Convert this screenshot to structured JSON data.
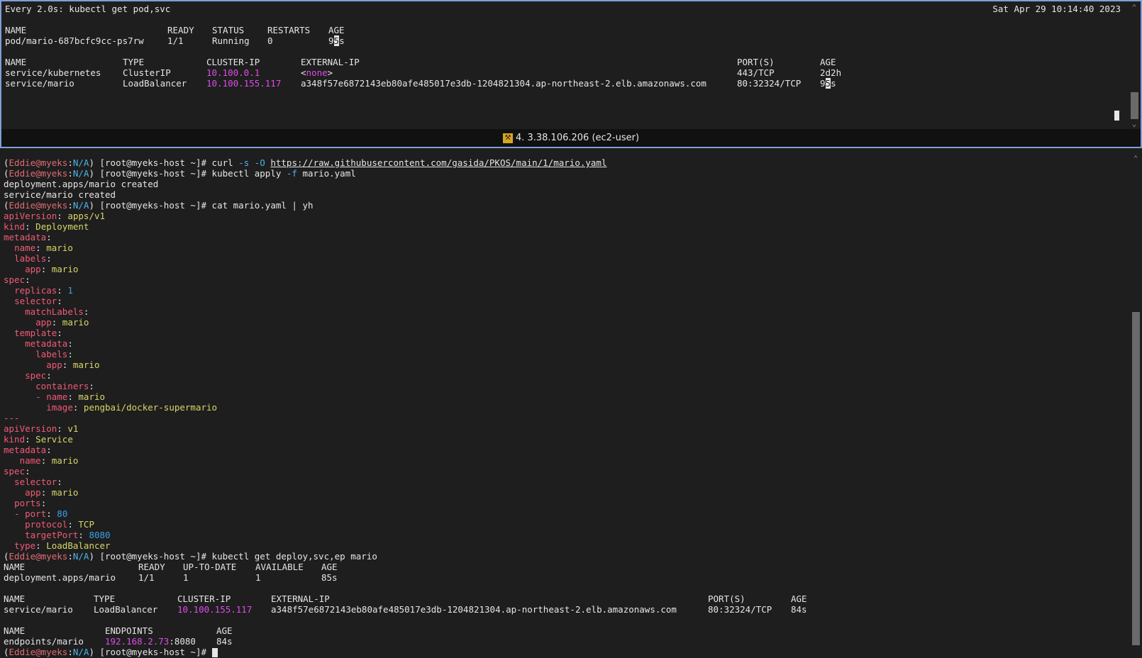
{
  "top_pane": {
    "header": "Every 2.0s: kubectl get pod,svc",
    "clock": "Sat Apr 29 10:14:40 2023",
    "pods_header": [
      "NAME",
      "READY",
      "STATUS",
      "RESTARTS",
      "AGE"
    ],
    "pod_row": {
      "name": "pod/mario-687bcfc9cc-ps7rw",
      "ready": "1/1",
      "status": "Running",
      "restarts": "0",
      "age_pre": "9",
      "age_cursor": "5",
      "age_post": "s"
    },
    "svc_header": [
      "NAME",
      "TYPE",
      "CLUSTER-IP",
      "EXTERNAL-IP",
      "PORT(S)",
      "AGE"
    ],
    "svc_rows": [
      {
        "name": "service/kubernetes",
        "type": "ClusterIP",
        "cluster_ip": "10.100.0.1",
        "external_ip_lt": "<",
        "external_ip": "none",
        "external_ip_gt": ">",
        "ports": "443/TCP",
        "age": "2d2h"
      },
      {
        "name": "service/mario",
        "type": "LoadBalancer",
        "cluster_ip": "10.100.155.117",
        "external_ip": "a348f57e6872143eb80afe485017e3db-1204821304.ap-northeast-2.elb.amazonaws.com",
        "ports": "80:32324/TCP",
        "age_pre": "9",
        "age_cursor": "5",
        "age_post": "s"
      }
    ],
    "status_bar": "4. 3.38.106.206 (ec2-user)"
  },
  "prompt": {
    "open": "(",
    "user": "Eddie@myeks",
    "colon": ":",
    "ns": "N/A",
    "close": ")",
    "host": " [root@myeks-host ~]# "
  },
  "bottom_pane": {
    "cmd1": {
      "a": "curl ",
      "flag": "-s -O",
      "url": "https://raw.githubusercontent.com/gasida/PKOS/main/1/mario.yaml"
    },
    "cmd2": {
      "a": "kubectl apply ",
      "flag": "-f",
      "b": " mario.yaml"
    },
    "out1": "deployment.apps/mario created",
    "out2": "service/mario created",
    "cmd3": "cat mario.yaml | yh",
    "yaml_sep": "---",
    "cmd4": "kubectl get deploy,svc,ep mario",
    "deploy_header": [
      "NAME",
      "READY",
      "UP-TO-DATE",
      "AVAILABLE",
      "AGE"
    ],
    "deploy_row": [
      "deployment.apps/mario",
      "1/1",
      "1",
      "1",
      "85s"
    ],
    "svc_header": [
      "NAME",
      "TYPE",
      "CLUSTER-IP",
      "EXTERNAL-IP",
      "PORT(S)",
      "AGE"
    ],
    "svc_row": [
      "service/mario",
      "LoadBalancer",
      "10.100.155.117",
      "a348f57e6872143eb80afe485017e3db-1204821304.ap-northeast-2.elb.amazonaws.com",
      "80:32324/TCP",
      "84s"
    ],
    "ep_header": [
      "NAME",
      "ENDPOINTS",
      "AGE"
    ],
    "ep_row": {
      "name": "endpoints/mario",
      "ip": "192.168.2.73",
      "port": ":8080",
      "age": "84s"
    }
  },
  "yaml": {
    "k_apiVersion": "apiVersion",
    "v_apps": "apps/v1",
    "k_kind": "kind",
    "v_deployment": "Deployment",
    "k_metadata": "metadata",
    "k_name": "name",
    "v_mario": "mario",
    "k_labels": "labels",
    "k_app": "app",
    "k_spec": "spec",
    "k_replicas": "replicas",
    "v_1": "1",
    "k_selector": "selector",
    "k_matchLabels": "matchLabels",
    "k_template": "template",
    "k_containers": "containers",
    "k_image": "image",
    "v_image": "pengbai/docker-supermario",
    "v_v1": "v1",
    "v_service": "Service",
    "k_ports": "ports",
    "k_port": "port",
    "v_80": "80",
    "k_protocol": "protocol",
    "v_tcp": "TCP",
    "k_targetPort": "targetPort",
    "v_8080": "8080",
    "k_type": "type",
    "v_lb": "LoadBalancer",
    "colon": ":",
    "colon_sp": ": ",
    "dash": "- "
  },
  "colors": {
    "background": "#1e1e1e",
    "ip_magenta": "#dd4ce6",
    "yaml_key": "#f25a78",
    "yaml_string": "#d7d769",
    "yaml_number": "#3aa0e8",
    "active_border": "#7f9fd6"
  }
}
